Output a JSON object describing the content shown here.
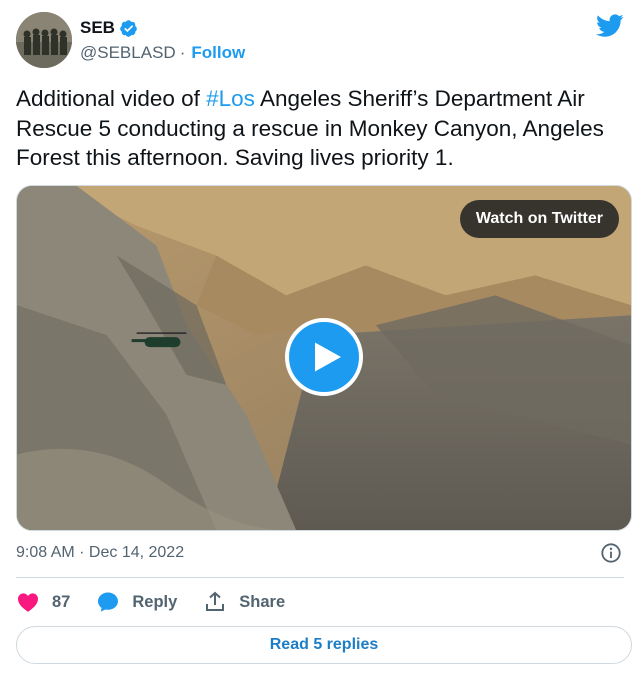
{
  "author": {
    "name": "SEB",
    "handle": "@SEBLASD",
    "separator": "·",
    "follow_label": "Follow"
  },
  "tweet": {
    "text_before": "Additional video of ",
    "hashtag": "#Los",
    "text_after": " Angeles Sheriff’s Department Air Rescue 5 conducting a rescue in Monkey Canyon, Angeles Forest this afternoon. Saving lives priority 1."
  },
  "media": {
    "watch_label": "Watch on Twitter"
  },
  "meta": {
    "timestamp": "9:08 AM · Dec 14, 2022"
  },
  "actions": {
    "likes": "87",
    "reply_label": "Reply",
    "share_label": "Share"
  },
  "read_replies_label": "Read 5 replies",
  "icons": {
    "verified": "verified-badge-icon",
    "brand": "twitter-bird-icon",
    "like": "heart-icon",
    "reply": "reply-bubble-icon",
    "share": "share-icon",
    "info": "info-icon",
    "play": "play-icon"
  },
  "colors": {
    "accent": "#1d9bf0",
    "like": "#f91880",
    "text": "#0f1419",
    "muted": "#536471",
    "border": "#cfd9de"
  }
}
